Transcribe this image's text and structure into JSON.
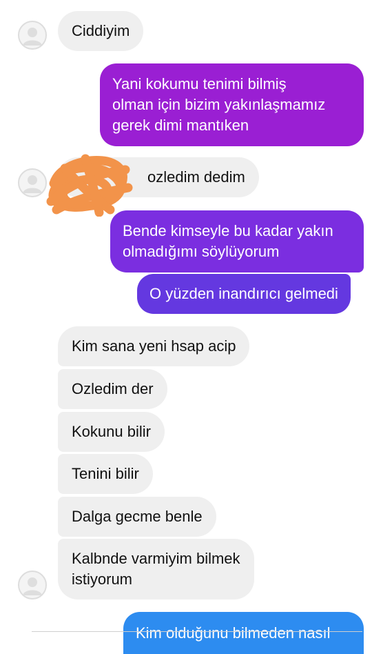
{
  "colors": {
    "incoming_bubble": "#efefef",
    "outgoing_purple": "#9a1fd3",
    "outgoing_indigo": "#6438e0",
    "outgoing_blue": "#2d8cf0",
    "redaction_scribble": "#f2934a"
  },
  "messages": [
    {
      "from": "other",
      "text": "Ciddiyim"
    },
    {
      "from": "me",
      "text": "Yani kokumu tenimi bilmiş\nolman için bizim yakınlaşmamız\ngerek dimi mantıken"
    },
    {
      "from": "other",
      "text": "ozledim dedim"
    },
    {
      "from": "me",
      "text": "Bende kimseyle bu kadar yakın\nolmadığımı söylüyorum"
    },
    {
      "from": "me",
      "text": "O yüzden inandırıcı gelmedi"
    },
    {
      "from": "other",
      "text": "Kim sana yeni hsap acip"
    },
    {
      "from": "other",
      "text": "Ozledim der"
    },
    {
      "from": "other",
      "text": "Kokunu bilir"
    },
    {
      "from": "other",
      "text": "Tenini bilir"
    },
    {
      "from": "other",
      "text": "Dalga gecme benle"
    },
    {
      "from": "other",
      "text": "Kalbnde varmiyim bilmek\nistiyorum"
    },
    {
      "from": "me",
      "text": "Kim olduğunu bilmeden nasıl"
    }
  ]
}
